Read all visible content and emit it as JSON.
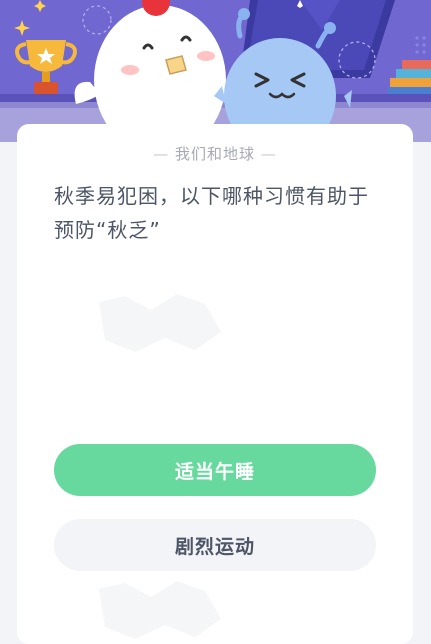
{
  "quiz": {
    "category": "我们和地球",
    "category_dash": "—",
    "question": "秋季易犯困，以下哪种习惯有助于预防“秋乏”",
    "options": [
      {
        "label": "适当午睡",
        "state": "selected"
      },
      {
        "label": "剧烈运动",
        "state": "normal"
      }
    ]
  },
  "colors": {
    "hero_bg": "#6d64cf",
    "page_bg": "#f3f4f7",
    "selected_option": "#68d99e",
    "question_text": "#4d5566"
  },
  "icons": [
    "trophy-icon",
    "star-sparkle-icon",
    "chick-mascot",
    "alien-mascot",
    "book-stack-icon",
    "window-frame"
  ]
}
